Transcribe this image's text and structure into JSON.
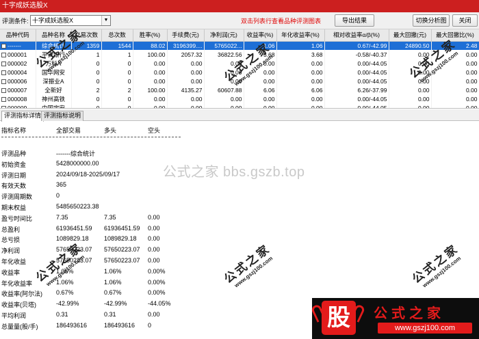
{
  "window": {
    "title": "十字成妖选股X"
  },
  "toolbar": {
    "condition_label": "评测条件:",
    "condition_value": "十字成妖选股X",
    "hint": "双击列表行查看品种评测图表",
    "export_label": "导出结果",
    "switch_label": "切换分析图",
    "close_label": "关闭"
  },
  "grid": {
    "columns": [
      "品种代码",
      "品种名称",
      "交易次数",
      "总次数",
      "胜率(%)",
      "手续费(元)",
      "净利润(元)",
      "收益率(%)",
      "年化收益率(%)",
      "相对收益率α/β(%)",
      "最大回撤(元)",
      "最大回撤比(%)"
    ],
    "rows": [
      [
        "-------",
        "综合统计",
        "1359",
        "1544",
        "88.02",
        "3196399....",
        "5765022...",
        "1.06",
        "1.06",
        "0.67/-42.99",
        "24890.50",
        "2.48"
      ],
      [
        "000001",
        "平安银行",
        "1",
        "1",
        "100.00",
        "2057.32",
        "36822.56",
        "3.68",
        "3.68",
        "-0.58/-40.37",
        "0.00",
        "0.00"
      ],
      [
        "000002",
        "万科A",
        "0",
        "0",
        "0.00",
        "0.00",
        "0.00",
        "0.00",
        "0.00",
        "0.00/-44.05",
        "0.00",
        "0.00"
      ],
      [
        "000004",
        "国华网安",
        "0",
        "0",
        "0.00",
        "0.00",
        "0.00",
        "0.00",
        "0.00",
        "0.00/-44.05",
        "0.00",
        "0.00"
      ],
      [
        "000006",
        "深振业A",
        "0",
        "0",
        "0.00",
        "0.00",
        "0.00",
        "0.00",
        "0.00",
        "0.00/-44.05",
        "0.00",
        "0.00"
      ],
      [
        "000007",
        "全新好",
        "2",
        "2",
        "100.00",
        "4135.27",
        "60607.88",
        "6.06",
        "6.06",
        "6.26/-37.99",
        "0.00",
        "0.00"
      ],
      [
        "000008",
        "神州高铁",
        "0",
        "0",
        "0.00",
        "0.00",
        "0.00",
        "0.00",
        "0.00",
        "0.00/-44.05",
        "0.00",
        "0.00"
      ],
      [
        "000009",
        "中国宝安",
        "0",
        "0",
        "0.00",
        "0.00",
        "0.00",
        "0.00",
        "0.00",
        "0.00/-44.05",
        "0.00",
        "0.00"
      ]
    ]
  },
  "tabs": [
    {
      "label": "评测指标详情"
    },
    {
      "label": "评测指标说明"
    }
  ],
  "detail": {
    "headers": [
      "指标名称",
      "全部交易",
      "多头",
      "空头"
    ],
    "rows": [
      {
        "name": "评测品种",
        "all": "-------综合统计",
        "long": "",
        "short": ""
      },
      {
        "name": "初始资金",
        "all": "5428000000.00",
        "long": "",
        "short": ""
      },
      {
        "name": "评测日期",
        "all": "2024/09/18-2025/09/17",
        "long": "",
        "short": ""
      },
      {
        "name": "有效天数",
        "all": "365",
        "long": "",
        "short": ""
      },
      {
        "name": "评测周期数",
        "all": "0",
        "long": "",
        "short": ""
      },
      {
        "name": "期末权益",
        "all": "5485650223.38",
        "long": "",
        "short": ""
      },
      {
        "name": "盈亏时间比",
        "all": "7.35",
        "long": "7.35",
        "short": "0.00"
      },
      {
        "name": "总盈利",
        "all": "61936451.59",
        "long": "61936451.59",
        "short": "0.00"
      },
      {
        "name": "总亏损",
        "all": "1089829.18",
        "long": "1089829.18",
        "short": "0.00"
      },
      {
        "name": "净利润",
        "all": "57650223.07",
        "long": "57650223.07",
        "short": "0.00"
      },
      {
        "name": "年化收益",
        "all": "57650223.07",
        "long": "57650223.07",
        "short": "0.00"
      },
      {
        "name": "收益率",
        "all": "1.06%",
        "long": "1.06%",
        "short": "0.00%"
      },
      {
        "name": "年化收益率",
        "all": "1.06%",
        "long": "1.06%",
        "short": "0.00%"
      },
      {
        "name": "收益率(阿尔法)",
        "all": "0.67%",
        "long": "0.67%",
        "short": "0.00%"
      },
      {
        "name": "收益率(贝塔)",
        "all": "-42.99%",
        "long": "-42.99%",
        "short": "-44.05%"
      },
      {
        "name": "平均利润",
        "all": "0.31",
        "long": "0.31",
        "short": "0.00"
      },
      {
        "name": "总量量(股/手)",
        "all": "186493616",
        "long": "186493616",
        "short": "0"
      }
    ]
  },
  "watermark": {
    "center": "公式之家 bbs.gszb.top",
    "stamp_text": "公式之家",
    "stamp_url": "www.gszj100.com"
  },
  "banner": {
    "logo": "股",
    "text": "公式之家",
    "url": "www.gszj100.com"
  },
  "colors": {
    "title_bg": "#cc1f1f",
    "selection": "#1e6fd6",
    "hint": "#e00000",
    "banner_red": "#e31b1b"
  }
}
